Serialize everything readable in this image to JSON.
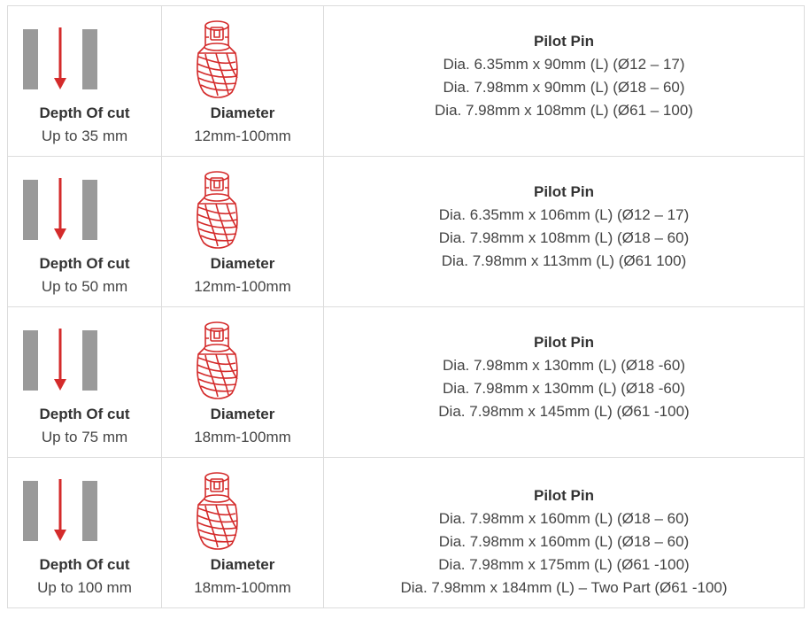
{
  "rows": [
    {
      "depth_label": "Depth Of cut",
      "depth_value": "Up to 35 mm",
      "diameter_label": "Diameter",
      "diameter_value": "12mm-100mm",
      "pin_title": "Pilot Pin",
      "pins": [
        "Dia. 6.35mm x 90mm (L) (Ø12 – 17)",
        "Dia. 7.98mm x 90mm (L) (Ø18 – 60)",
        "Dia. 7.98mm x 108mm (L) (Ø61 – 100)"
      ]
    },
    {
      "depth_label": "Depth Of cut",
      "depth_value": "Up to 50 mm",
      "diameter_label": "Diameter",
      "diameter_value": "12mm-100mm",
      "pin_title": "Pilot Pin",
      "pins": [
        "Dia. 6.35mm x 106mm (L) (Ø12 – 17)",
        "Dia. 7.98mm x 108mm (L) (Ø18 – 60)",
        "Dia. 7.98mm x 113mm (L) (Ø61 100)"
      ]
    },
    {
      "depth_label": "Depth Of cut",
      "depth_value": "Up to 75 mm",
      "diameter_label": "Diameter",
      "diameter_value": "18mm-100mm",
      "pin_title": "Pilot Pin",
      "pins": [
        "Dia. 7.98mm x 130mm (L) (Ø18 -60)",
        "Dia. 7.98mm x 130mm (L) (Ø18 -60)",
        "Dia. 7.98mm x 145mm (L) (Ø61 -100)"
      ]
    },
    {
      "depth_label": "Depth Of cut",
      "depth_value": "Up to 100 mm",
      "diameter_label": "Diameter",
      "diameter_value": "18mm-100mm",
      "pin_title": "Pilot Pin",
      "pins": [
        "Dia. 7.98mm x 160mm (L) (Ø18 – 60)",
        "Dia. 7.98mm x 160mm (L) (Ø18 – 60)",
        "Dia. 7.98mm x 175mm (L) (Ø61 -100)",
        "Dia. 7.98mm x 184mm (L) – Two Part (Ø61 -100)"
      ]
    }
  ],
  "icons": {
    "depth": "depth-of-cut-icon",
    "cutter": "cutter-gear-icon"
  },
  "colors": {
    "accent_red": "#d42b2b",
    "bar_gray": "#9a9a9a",
    "border": "#dcdcdc"
  }
}
